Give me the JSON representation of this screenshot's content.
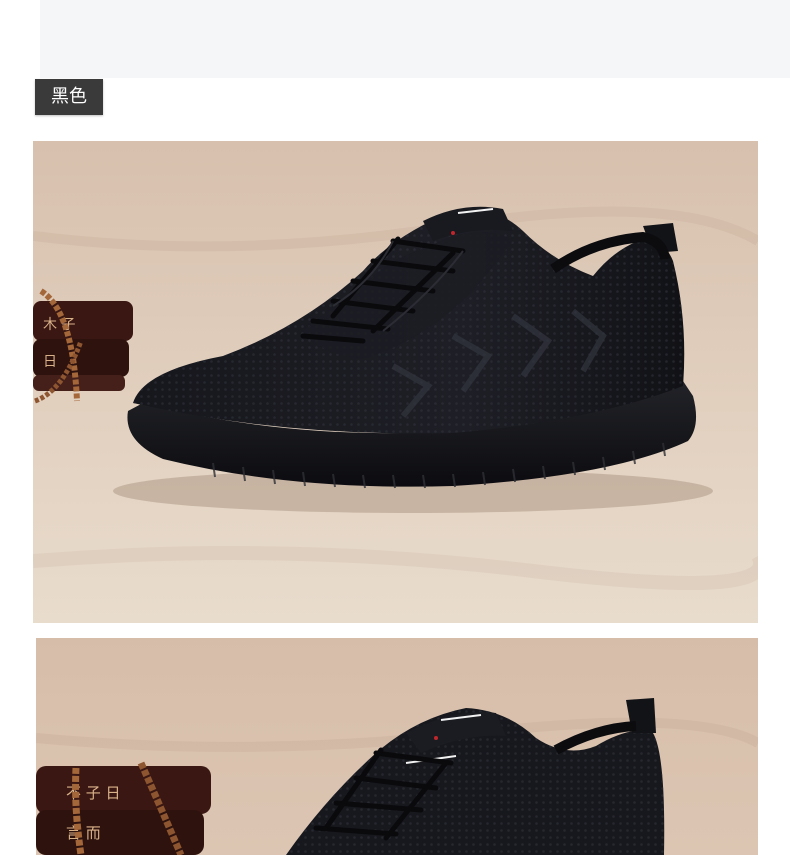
{
  "color_label": "黑色",
  "colors": {
    "tag_background": "#3a3a3a",
    "tag_text": "#ffffff",
    "backdrop": "#dcc7b4",
    "shoe": "#15161b",
    "top_panel": "#f4f6f8"
  },
  "photos": [
    {
      "subject": "black-knit-sneaker-side-view"
    },
    {
      "subject": "black-knit-sneaker-close-view"
    }
  ]
}
